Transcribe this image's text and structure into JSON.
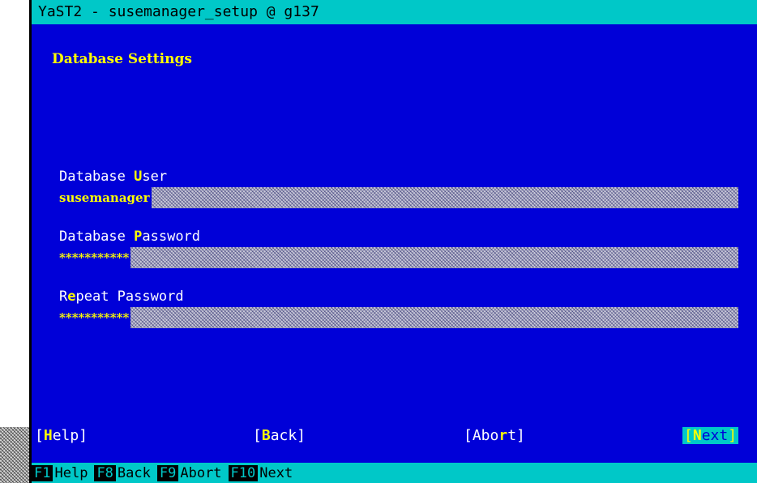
{
  "window": {
    "title": "YaST2 - susemanager_setup @ g137"
  },
  "dialog": {
    "heading": "Database Settings",
    "fields": [
      {
        "label_pre": "Database ",
        "hotkey": "U",
        "label_post": "ser",
        "value": "susemanager"
      },
      {
        "label_pre": "Database ",
        "hotkey": "P",
        "label_post": "assword",
        "value": "***********"
      },
      {
        "label_pre": "R",
        "hotkey": "e",
        "label_post": "peat Password",
        "value": "***********"
      }
    ]
  },
  "buttons": {
    "help": {
      "open": "[",
      "hotkey": "H",
      "rest": "elp",
      "close": "]"
    },
    "back": {
      "open": "[",
      "hotkey": "B",
      "rest": "ack",
      "close": "]"
    },
    "abort": {
      "open": "[",
      "pre": "Abo",
      "hotkey": "r",
      "rest": "t",
      "close": "]"
    },
    "next": {
      "open": "[",
      "hotkey": "N",
      "rest": "ext",
      "close": "]"
    }
  },
  "fkeys": [
    {
      "key": "F1",
      "label": "Help"
    },
    {
      "key": "F8",
      "label": "Back"
    },
    {
      "key": "F9",
      "label": "Abort"
    },
    {
      "key": "F10",
      "label": "Next"
    }
  ],
  "colors": {
    "background": "#0000d8",
    "titlebar": "#00c8c8",
    "hotkey": "#ffff00",
    "text": "#ffffff"
  }
}
